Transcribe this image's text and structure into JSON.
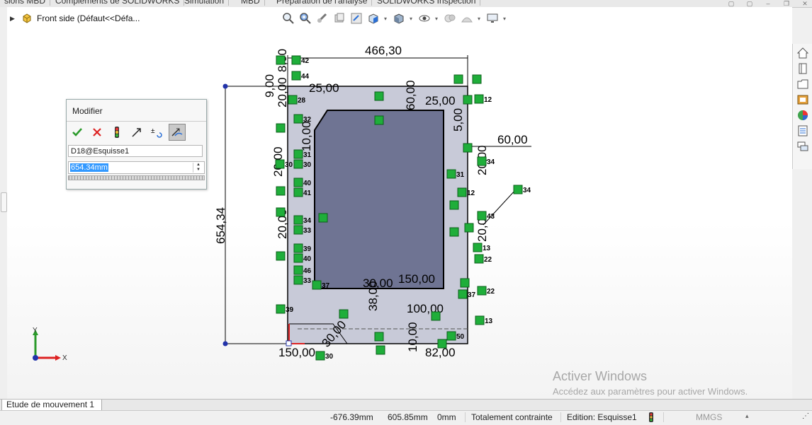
{
  "tabs": [
    "sions MBD",
    "Compléments de SOLIDWORKS",
    "Simulation",
    "MBD",
    "Préparation de l'analyse",
    "SOLIDWORKS Inspection"
  ],
  "feature_tree": {
    "label": "Front side  (Défaut<<Défa..."
  },
  "modifier": {
    "title": "Modifier",
    "dimension_name": "D18@Esquisse1",
    "value": "654.34mm"
  },
  "sketch": {
    "main_dims": {
      "width_top": "466,30",
      "height_left": "654,34",
      "right_offset": "60,00",
      "top_a": "25,00",
      "top_b": "60,00",
      "top_c": "25,00",
      "mid_a": "150,00",
      "mid_b": "30,00",
      "mid_c": "38,00",
      "bot_a": "100,00",
      "bot_b": "82,00",
      "bot_c": "150,00",
      "bot_d": "10,00",
      "left_a": "20,00",
      "left_b": "9,00",
      "left_c": "8,00",
      "left_d": "20,00",
      "left_e": "20,00",
      "right_a": "20,00",
      "right_b": "20,00",
      "right_c": "5,00",
      "cut_a": "30,00",
      "cut_b": "10,00"
    },
    "relation_numbers": [
      "42",
      "44",
      "28",
      "32",
      "31",
      "30",
      "40",
      "41",
      "34",
      "33",
      "39",
      "40",
      "46",
      "33",
      "37",
      "39",
      "12",
      "31",
      "43",
      "22",
      "13",
      "22",
      "37",
      "12",
      "13",
      "50",
      "34",
      "30",
      "30",
      "34"
    ]
  },
  "triad": {
    "y": "Y",
    "x": "X"
  },
  "watermark": {
    "line1": "Activer Windows",
    "line2": "Accédez aux paramètres pour activer Windows."
  },
  "motion_tab": "Etude de mouvement 1",
  "status": {
    "x": "-676.39mm",
    "y": "605.85mm",
    "z": "0mm",
    "state": "Totalement contrainte",
    "edition": "Edition: Esquisse1",
    "units": "MMGS"
  }
}
